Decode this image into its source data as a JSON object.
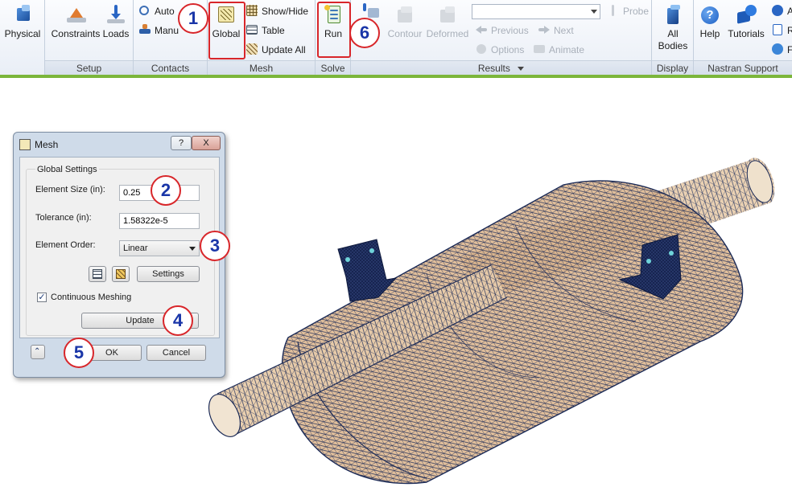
{
  "ribbon": {
    "panels": {
      "setup": "Setup",
      "contacts": "Contacts",
      "mesh": "Mesh",
      "solve": "Solve",
      "results": "Results",
      "display": "Display",
      "nastran_support": "Nastran Support"
    },
    "buttons": {
      "physical": "Physical",
      "constraints": "Constraints",
      "loads": "Loads",
      "auto": "Auto",
      "manual": "Manu",
      "global": "Global",
      "show_hide": "Show/Hide",
      "table": "Table",
      "update_all": "Update  All",
      "run": "Run",
      "contour": "Contour",
      "deformed": "Deformed",
      "probe": "Probe",
      "previous": "Previous",
      "next": "Next",
      "options": "Options",
      "animate": "Animate",
      "all_bodies_1": "All",
      "all_bodies_2": "Bodies",
      "help": "Help",
      "tutorials": "Tutorials",
      "stub1": "A",
      "stub2": "R",
      "stub3": "F"
    },
    "results_dropdown_value": ""
  },
  "annotations": [
    "1",
    "2",
    "3",
    "4",
    "5",
    "6"
  ],
  "dialog": {
    "title": "Mesh",
    "help_label": "?",
    "close_label": "X",
    "group_label": "Global Settings",
    "element_size_label": "Element Size (in):",
    "element_size_value": "0.25",
    "tolerance_label": "Tolerance (in):",
    "tolerance_value": "1.58322e-5",
    "element_order_label": "Element Order:",
    "element_order_value": "Linear",
    "settings_label": "Settings",
    "continuous_meshing_label": "Continuous Meshing",
    "continuous_meshing_checked": true,
    "update_label": "Update",
    "ok_label": "OK",
    "cancel_label": "Cancel"
  },
  "colors": {
    "annotation_ring": "#d8262a",
    "annotation_text": "#1a36a8",
    "mesh_fill": "#e6c8a6",
    "mesh_lines": "#1c2b57",
    "ribbon_accent": "#7bb63a"
  }
}
